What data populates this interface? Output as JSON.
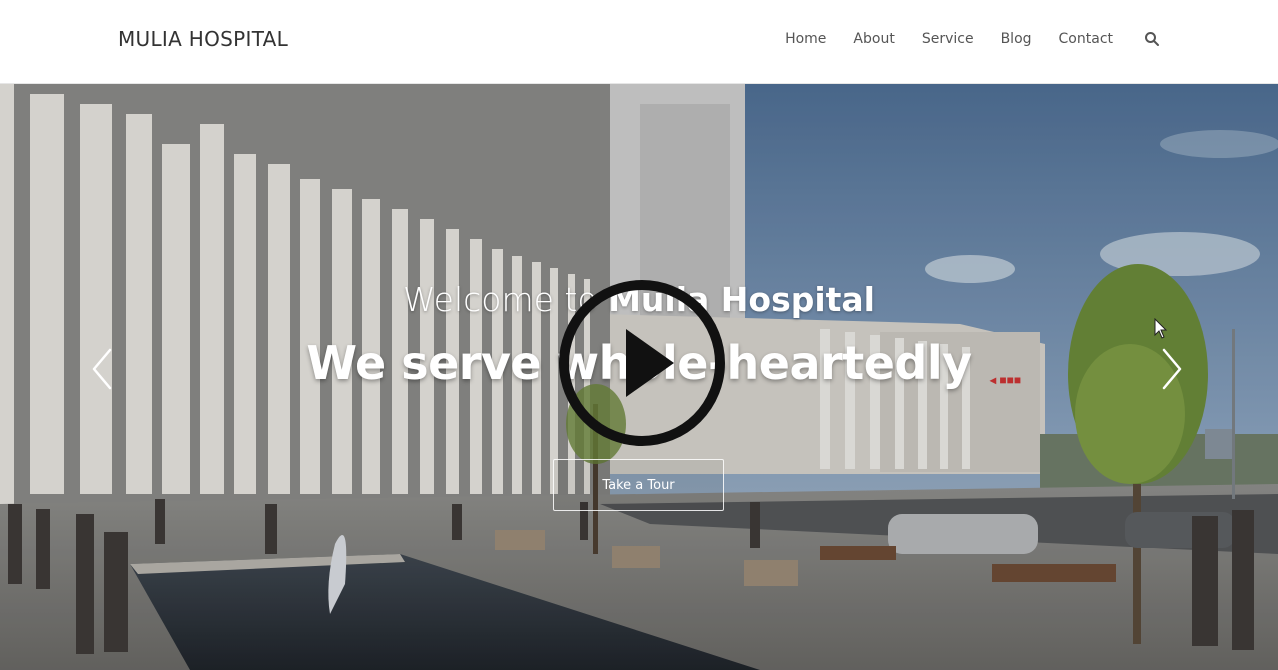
{
  "header": {
    "brand": "MULIA HOSPITAL",
    "nav": [
      {
        "label": "Home"
      },
      {
        "label": "About"
      },
      {
        "label": "Service"
      },
      {
        "label": "Blog"
      },
      {
        "label": "Contact"
      }
    ],
    "search_icon": "search-icon"
  },
  "hero": {
    "welcome_prefix": "Welcome to",
    "welcome_name": "Mulia Hospital",
    "headline": "We serve whole-heartedly",
    "button_label": "Take a Tour",
    "prev_icon": "chevron-left-icon",
    "next_icon": "chevron-right-icon",
    "play_icon": "play-icon"
  },
  "colors": {
    "text_dark": "#333333",
    "nav_text": "#555555",
    "hero_text": "#ffffff",
    "sky": "#5d7fa6",
    "building": "#d9d6d0"
  }
}
